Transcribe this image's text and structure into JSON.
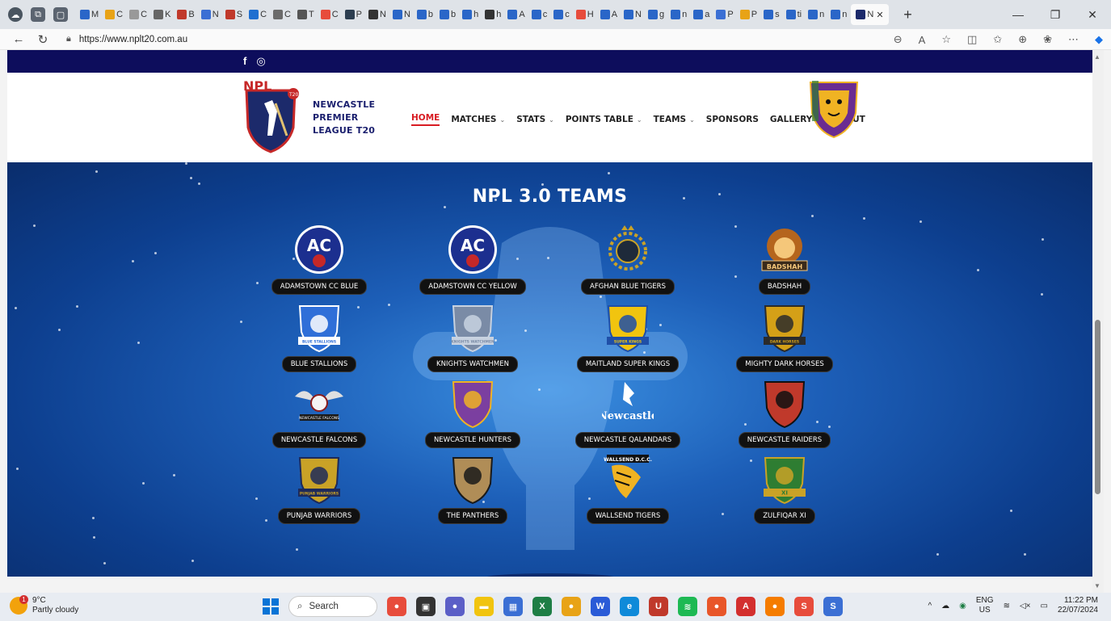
{
  "browser": {
    "tabs": [
      {
        "label": "M",
        "color": "#2a66c8"
      },
      {
        "label": "C",
        "color": "#e8a317"
      },
      {
        "label": "C",
        "color": "#999999"
      },
      {
        "label": "K",
        "color": "#666666"
      },
      {
        "label": "B",
        "color": "#c0392b"
      },
      {
        "label": "N",
        "color": "#3b6fd4"
      },
      {
        "label": "S",
        "color": "#c0392b"
      },
      {
        "label": "C",
        "color": "#1f6fd0"
      },
      {
        "label": "C",
        "color": "#6b6b6b"
      },
      {
        "label": "T",
        "color": "#555555"
      },
      {
        "label": "C",
        "color": "#e74c3c"
      },
      {
        "label": "P",
        "color": "#2c3e50"
      },
      {
        "label": "N",
        "color": "#333333"
      },
      {
        "label": "N",
        "color": "#2a66c8"
      },
      {
        "label": "b",
        "color": "#2a66c8"
      },
      {
        "label": "b",
        "color": "#2a66c8"
      },
      {
        "label": "h",
        "color": "#2a66c8"
      },
      {
        "label": "h",
        "color": "#333333"
      },
      {
        "label": "A",
        "color": "#2a66c8"
      },
      {
        "label": "c",
        "color": "#2a66c8"
      },
      {
        "label": "c",
        "color": "#2a66c8"
      },
      {
        "label": "H",
        "color": "#e74c3c"
      },
      {
        "label": "A",
        "color": "#2a66c8"
      },
      {
        "label": "N",
        "color": "#2a66c8"
      },
      {
        "label": "g",
        "color": "#2a66c8"
      },
      {
        "label": "n",
        "color": "#2a66c8"
      },
      {
        "label": "a",
        "color": "#2a66c8"
      },
      {
        "label": "P",
        "color": "#3b6fd4"
      },
      {
        "label": "P",
        "color": "#e8a317"
      },
      {
        "label": "s",
        "color": "#2a66c8"
      },
      {
        "label": "ti",
        "color": "#2a66c8"
      },
      {
        "label": "n",
        "color": "#2a66c8"
      },
      {
        "label": "n",
        "color": "#2a66c8"
      }
    ],
    "active_tab": "N",
    "new_tab": "+",
    "url": "https://www.nplt20.com.au"
  },
  "site": {
    "social": [
      "f",
      "◎"
    ],
    "brand_lines": [
      "NEWCASTLE",
      "PREMIER",
      "LEAGUE T20"
    ],
    "menu": [
      {
        "label": "HOME",
        "active": true,
        "dropdown": false
      },
      {
        "label": "MATCHES",
        "active": false,
        "dropdown": true
      },
      {
        "label": "STATS",
        "active": false,
        "dropdown": true
      },
      {
        "label": "POINTS TABLE",
        "active": false,
        "dropdown": true
      },
      {
        "label": "TEAMS",
        "active": false,
        "dropdown": true
      },
      {
        "label": "SPONSORS",
        "active": false,
        "dropdown": false
      },
      {
        "label": "GALLERY",
        "active": false,
        "dropdown": true
      },
      {
        "label": "ABOUT",
        "active": false,
        "dropdown": false
      }
    ],
    "section_title": "NPL 3.0 TEAMS",
    "teams": [
      {
        "name": "ADAMSTOWN CC BLUE",
        "icon": "ac-blue-crest",
        "crest_text": "AC",
        "colors": [
          "#1c2f8f",
          "#ffffff"
        ]
      },
      {
        "name": "ADAMSTOWN CC YELLOW",
        "icon": "ac-yellow-crest",
        "crest_text": "AC",
        "colors": [
          "#1c2f8f",
          "#ffffff"
        ]
      },
      {
        "name": "AFGHAN BLUE TIGERS",
        "icon": "laurel-crest",
        "crest_text": "",
        "colors": [
          "#c9a227",
          "#1e2a3a"
        ]
      },
      {
        "name": "BADSHAH",
        "icon": "lion-crest",
        "crest_text": "BADSHAH",
        "colors": [
          "#b5651d",
          "#f5c77a"
        ]
      },
      {
        "name": "BLUE STALLIONS",
        "icon": "stallion-crest",
        "crest_text": "BLUE STALLIONS",
        "colors": [
          "#2f6fd8",
          "#ffffff"
        ]
      },
      {
        "name": "KNIGHTS WATCHMEN",
        "icon": "knight-crest",
        "crest_text": "KNIGHTS WATCHMEN",
        "colors": [
          "#7a8ba6",
          "#c8d2e0"
        ]
      },
      {
        "name": "MAITLAND SUPER KINGS",
        "icon": "super-kings-crest",
        "crest_text": "SUPER KINGS",
        "colors": [
          "#f1c40f",
          "#1f4fa8"
        ]
      },
      {
        "name": "MIGHTY DARK HORSES",
        "icon": "dark-horse-crest",
        "crest_text": "DARK HORSES",
        "colors": [
          "#d4a017",
          "#2b2b2b"
        ]
      },
      {
        "name": "NEWCASTLE FALCONS",
        "icon": "falcon-crest",
        "crest_text": "NEWCASTLE FALCONS",
        "colors": [
          "#e0e0e0",
          "#8a1c1c"
        ]
      },
      {
        "name": "NEWCASTLE HUNTERS",
        "icon": "tiger-crest",
        "crest_text": "",
        "colors": [
          "#7b3fa0",
          "#f0b323"
        ]
      },
      {
        "name": "NEWCASTLE QALANDARS",
        "icon": "eagle-crest",
        "crest_text": "Newcastle",
        "colors": [
          "#ffffff",
          "#1a1a1a"
        ]
      },
      {
        "name": "NEWCASTLE RAIDERS",
        "icon": "raider-crest",
        "crest_text": "",
        "colors": [
          "#c0392b",
          "#111111"
        ]
      },
      {
        "name": "PUNJAB WARRIORS",
        "icon": "warrior-crest",
        "crest_text": "PUNJAB WARRIORS",
        "colors": [
          "#c9a227",
          "#1e2a5a"
        ]
      },
      {
        "name": "THE PANTHERS",
        "icon": "panther-crest",
        "crest_text": "",
        "colors": [
          "#b08d57",
          "#1a1a1a"
        ]
      },
      {
        "name": "WALLSEND TIGERS",
        "icon": "wallsend-tiger-crest",
        "crest_text": "WALLSEND D.C.C.",
        "colors": [
          "#f0b323",
          "#111111"
        ]
      },
      {
        "name": "ZULFIQAR XI",
        "icon": "zulfiqar-crest",
        "crest_text": "XI",
        "colors": [
          "#2e7d32",
          "#c9a227"
        ]
      }
    ]
  },
  "taskbar": {
    "weather_temp": "9°C",
    "weather_desc": "Partly cloudy",
    "weather_badge": "1",
    "search_label": "Search",
    "lang_top": "ENG",
    "lang_bottom": "US",
    "time": "11:22 PM",
    "date": "22/07/2024",
    "apps": [
      {
        "icon": "widgets-icon",
        "color": "#e74c3c",
        "glyph": "●"
      },
      {
        "icon": "task-view-icon",
        "color": "#333333",
        "glyph": "▣"
      },
      {
        "icon": "chat-icon",
        "color": "#5b5fc7",
        "glyph": "●"
      },
      {
        "icon": "file-explorer-icon",
        "color": "#f1c40f",
        "glyph": "▬"
      },
      {
        "icon": "store-icon",
        "color": "#3b6fd4",
        "glyph": "▦"
      },
      {
        "icon": "excel-icon",
        "color": "#1e7e45",
        "glyph": "X"
      },
      {
        "icon": "chrome-icon",
        "color": "#e8a317",
        "glyph": "●"
      },
      {
        "icon": "word-icon",
        "color": "#2a5bd7",
        "glyph": "W"
      },
      {
        "icon": "edge-icon",
        "color": "#0f8ad9",
        "glyph": "e"
      },
      {
        "icon": "mcafee-icon",
        "color": "#c0392b",
        "glyph": "U"
      },
      {
        "icon": "spotify-icon",
        "color": "#1db954",
        "glyph": "≋"
      },
      {
        "icon": "firefox-dev-icon",
        "color": "#e8562a",
        "glyph": "●"
      },
      {
        "icon": "acrobat-icon",
        "color": "#d32f2f",
        "glyph": "A"
      },
      {
        "icon": "firefox-icon",
        "color": "#f57c00",
        "glyph": "●"
      },
      {
        "icon": "app-s-red-icon",
        "color": "#e74c3c",
        "glyph": "S"
      },
      {
        "icon": "app-s-blue-icon",
        "color": "#3b6fd4",
        "glyph": "S"
      }
    ]
  }
}
